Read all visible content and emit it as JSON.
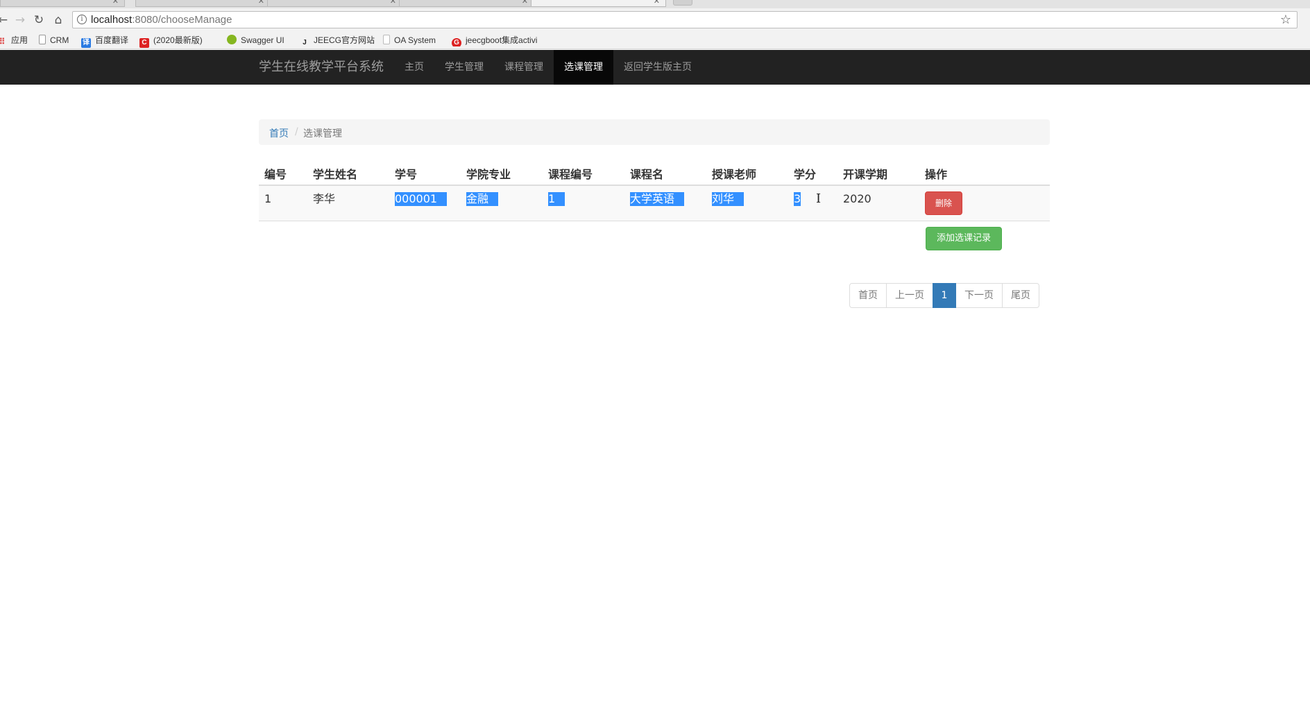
{
  "browser": {
    "url_host": "localhost",
    "url_path": ":8080/chooseManage",
    "bookmarks": [
      {
        "label": "应用",
        "icon": "apps-grid-icon"
      },
      {
        "label": "CRM",
        "icon": "page-icon"
      },
      {
        "label": "百度翻译",
        "icon": "translate-icon"
      },
      {
        "label": "(2020最新版)",
        "icon": "c-logo-icon"
      },
      {
        "label": "Swagger UI",
        "icon": "swagger-icon"
      },
      {
        "label": "JEECG官方网站",
        "icon": "j-logo-icon"
      },
      {
        "label": "OA System",
        "icon": "page-icon"
      },
      {
        "label": "jeecgboot集成activi",
        "icon": "g-logo-icon"
      }
    ]
  },
  "navbar": {
    "brand": "学生在线教学平台系统",
    "items": [
      {
        "label": "主页",
        "active": false
      },
      {
        "label": "学生管理",
        "active": false
      },
      {
        "label": "课程管理",
        "active": false
      },
      {
        "label": "选课管理",
        "active": true
      },
      {
        "label": "返回学生版主页",
        "active": false
      }
    ]
  },
  "breadcrumb": {
    "home": "首页",
    "separator": "/",
    "current": "选课管理"
  },
  "table": {
    "headers": [
      "编号",
      "学生姓名",
      "学号",
      "学院专业",
      "课程编号",
      "课程名",
      "授课老师",
      "学分",
      "开课学期",
      "操作"
    ],
    "rows": [
      {
        "id": "1",
        "name": "李华",
        "student_no": "000001",
        "major": "金融",
        "course_no": "1",
        "course_name": "大学英语",
        "teacher": "刘华",
        "credit": "3",
        "term": "2020",
        "delete_label": "删除"
      }
    ],
    "add_label": "添加选课记录"
  },
  "pagination": {
    "first": "首页",
    "prev": "上一页",
    "current": "1",
    "next": "下一页",
    "last": "尾页"
  },
  "colors": {
    "navbar_bg": "#222222",
    "active_nav_bg": "#080808",
    "danger": "#d9534f",
    "success": "#5cb85c",
    "primary": "#337ab7",
    "selection": "#3390ff"
  }
}
